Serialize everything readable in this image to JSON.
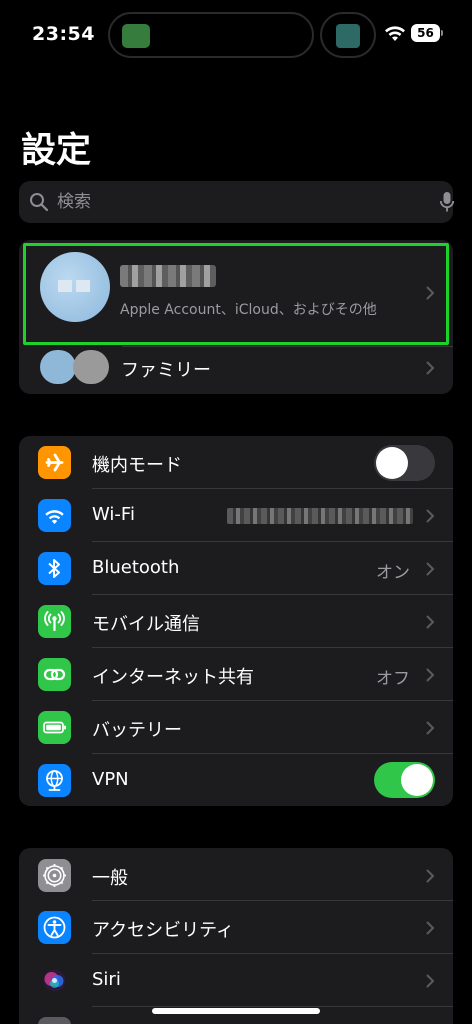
{
  "status_bar": {
    "time": "23:54",
    "battery": "56"
  },
  "header": {
    "title": "設定"
  },
  "search": {
    "placeholder": "検索"
  },
  "account": {
    "subtitle": "Apple Account、iCloud、およびその他",
    "family_label": "ファミリー"
  },
  "connectivity": {
    "items": [
      {
        "label": "機内モード",
        "icon": "airplane-icon",
        "color": "#FF9500",
        "toggle": false
      },
      {
        "label": "Wi-Fi",
        "icon": "wifi-icon",
        "color": "#0A84FF"
      },
      {
        "label": "Bluetooth",
        "icon": "bluetooth-icon",
        "color": "#0A84FF",
        "value": "オン"
      },
      {
        "label": "モバイル通信",
        "icon": "antenna-icon",
        "color": "#30C64A"
      },
      {
        "label": "インターネット共有",
        "icon": "chain-link-icon",
        "color": "#30C64A",
        "value": "オフ"
      },
      {
        "label": "バッテリー",
        "icon": "battery-icon",
        "color": "#30C64A"
      },
      {
        "label": "VPN",
        "icon": "globe-icon",
        "color": "#0A84FF",
        "toggle": true
      }
    ]
  },
  "general": {
    "items": [
      {
        "label": "一般",
        "icon": "gear-icon",
        "color": "#8E8E93"
      },
      {
        "label": "アクセシビリティ",
        "icon": "accessibility-icon",
        "color": "#0A84FF"
      },
      {
        "label": "Siri",
        "icon": "siri-icon",
        "color": "#1C1C1E"
      }
    ]
  },
  "colors": {
    "background": "#000000",
    "cell": "#1C1C1E",
    "highlight": "#1FD12B",
    "toggle_on": "#30C64A"
  }
}
